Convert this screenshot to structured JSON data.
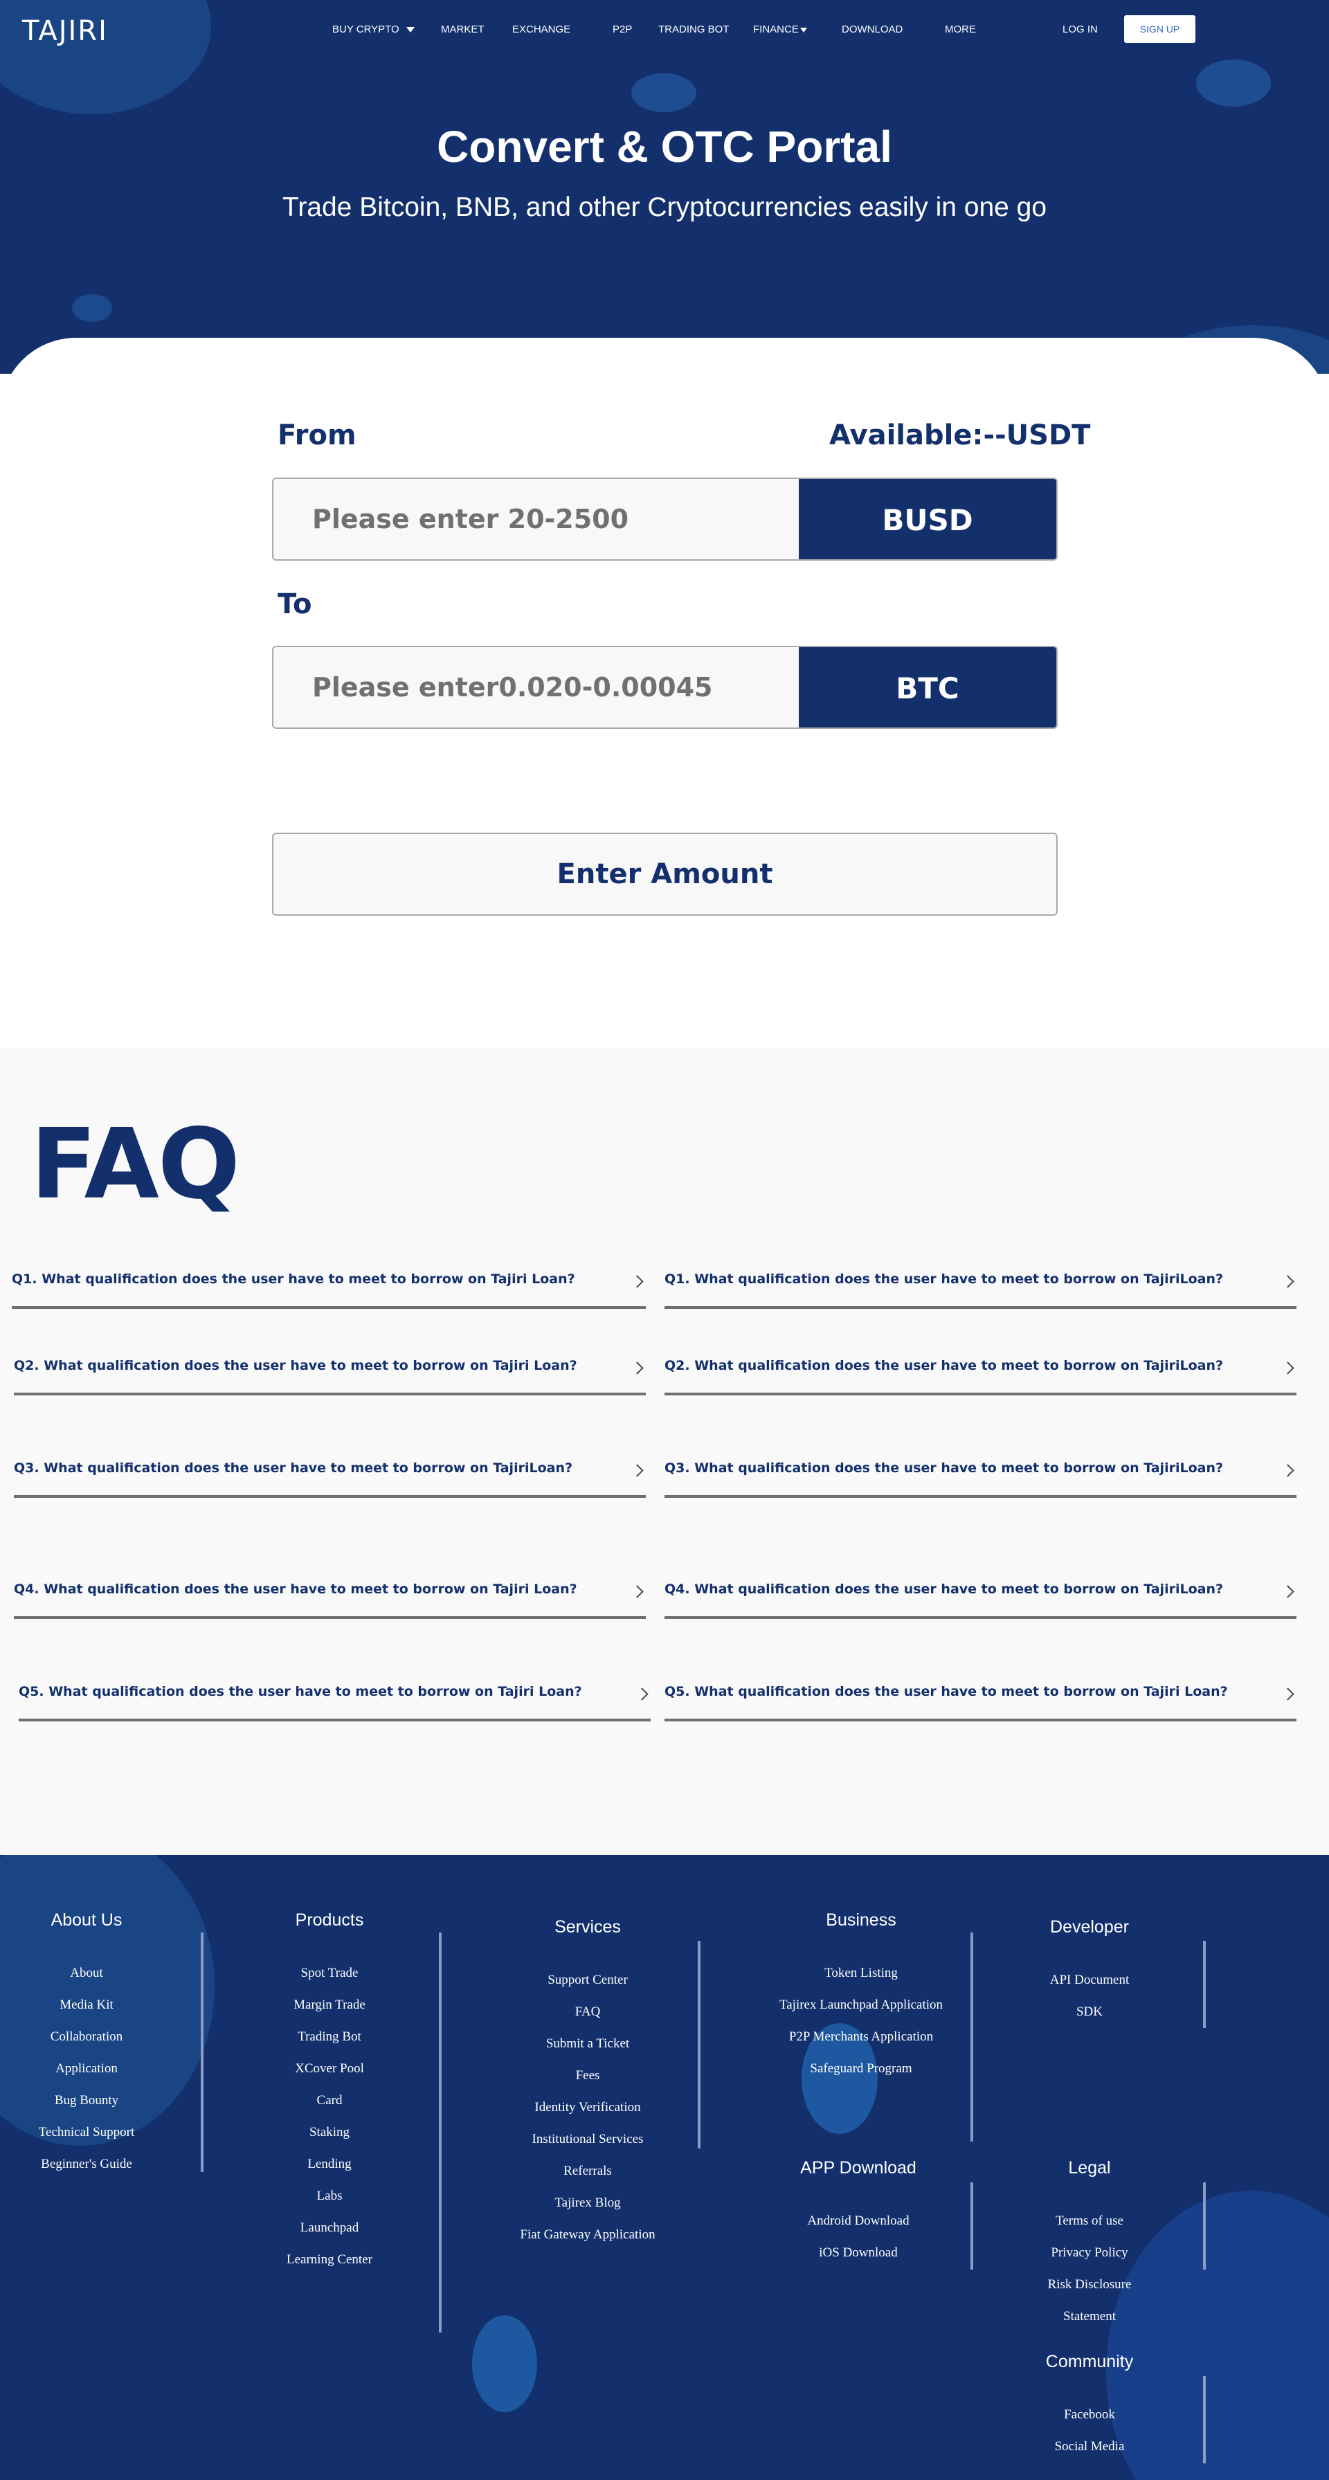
{
  "brand": {
    "logo": "TAJIRI"
  },
  "nav": {
    "items": [
      {
        "label": "BUY CRYPTO"
      },
      {
        "label": "MARKET"
      },
      {
        "label": "EXCHANGE"
      },
      {
        "label": "P2P"
      },
      {
        "label": "TRADING BOT"
      },
      {
        "label": "FINANCE"
      },
      {
        "label": "DOWNLOAD"
      },
      {
        "label": "MORE"
      }
    ],
    "login": "LOG IN",
    "signup": "SIGN UP"
  },
  "hero": {
    "title": "Convert & OTC Portal",
    "subtitle": "Trade Bitcoin, BNB, and other Cryptocurrencies easily in one go"
  },
  "convert": {
    "from_label": "From",
    "available": "Available:--USDT",
    "from_placeholder": "Please enter 20-2500",
    "from_currency": "BUSD",
    "to_label": "To",
    "to_placeholder": "Please enter0.020-0.00045",
    "to_currency": "BTC",
    "submit_label": "Enter Amount"
  },
  "faq": {
    "title": "FAQ",
    "left": [
      "Q1. What qualification does the user have to meet to borrow on Tajiri Loan?",
      "Q2. What qualification does the user have to meet to borrow on Tajiri Loan?",
      "Q3. What qualification does the user have to meet to borrow on  TajiriLoan?",
      "Q4. What qualification does the user have to meet to borrow on  Tajiri Loan?",
      "Q5. What qualification does the user have to meet to borrow on  Tajiri Loan?"
    ],
    "right": [
      "Q1. What qualification does the user have to meet to borrow on  TajiriLoan?",
      "Q2. What qualification does the user have to meet to borrow on  TajiriLoan?",
      "Q3. What qualification does the user have to meet to borrow on  TajiriLoan?",
      "Q4. What qualification does the user have to meet to borrow on  TajiriLoan?",
      "Q5. What qualification does the user have to meet to borrow on  Tajiri Loan?"
    ]
  },
  "footer": {
    "about": {
      "heading": "About Us",
      "links": [
        "About",
        "Media Kit",
        "Collaboration",
        "Application",
        "Bug Bounty",
        "Technical Support",
        "Beginner's Guide"
      ]
    },
    "products": {
      "heading": "Products",
      "links": [
        "Spot Trade",
        "Margin Trade",
        "Trading Bot",
        "XCover Pool",
        "Card",
        "Staking",
        "Lending",
        "Labs",
        "Launchpad",
        "Learning Center"
      ]
    },
    "services": {
      "heading": "Services",
      "links": [
        "Support Center",
        "FAQ",
        "Submit a Ticket",
        "Fees",
        "Identity Verification",
        "Institutional Services",
        "Referrals",
        "Tajirex Blog",
        "Fiat Gateway Application"
      ]
    },
    "business": {
      "heading": "Business",
      "links": [
        "Token Listing",
        "Tajirex Launchpad Application",
        "P2P Merchants Application",
        "Safeguard Program"
      ]
    },
    "developer": {
      "heading": "Developer",
      "links": [
        "API Document",
        "SDK"
      ]
    },
    "app_download": {
      "heading": "APP Download",
      "links": [
        "Android Download",
        "iOS Download"
      ]
    },
    "legal": {
      "heading": "Legal",
      "links": [
        "Terms of use",
        "Privacy Policy",
        "Risk Disclosure",
        "Statement"
      ]
    },
    "community": {
      "heading": "Community",
      "links": [
        "Facebook",
        "Social Media"
      ]
    }
  }
}
